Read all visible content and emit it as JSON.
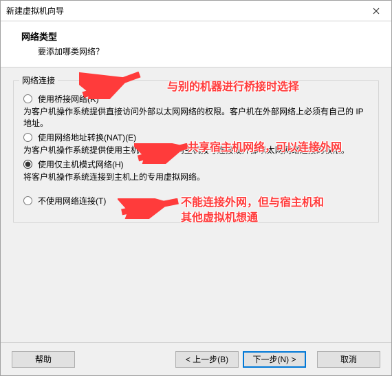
{
  "window": {
    "title": "新建虚拟机向导"
  },
  "header": {
    "heading": "网络类型",
    "subheading": "要添加哪类网络？"
  },
  "fieldset": {
    "legend": "网络连接",
    "options": [
      {
        "label": "使用桥接网络(R)",
        "desc": "为客户机操作系统提供直接访问外部以太网网络的权限。客户机在外部网络上必须有自己的 IP 地址。",
        "checked": false
      },
      {
        "label": "使用网络地址转换(NAT)(E)",
        "desc": "为客户机操作系统提供使用主机 IP 地址访问主机拨号连接或外部以太网网络连接的权限。",
        "checked": false
      },
      {
        "label": "使用仅主机模式网络(H)",
        "desc": "将客户机操作系统连接到主机上的专用虚拟网络。",
        "checked": true
      },
      {
        "label": "不使用网络连接(T)",
        "desc": "",
        "checked": false
      }
    ]
  },
  "footer": {
    "help": "帮助",
    "back": "< 上一步(B)",
    "next": "下一步(N) >",
    "cancel": "取消"
  },
  "annotations": {
    "a1": "与别的机器进行桥接时选择",
    "a2": "共享宿主机网络，可以连接外网",
    "a3_line1": "不能连接外网，但与宿主机和",
    "a3_line2": "其他虚拟机想通"
  },
  "colors": {
    "annotation": "#ff3b3b",
    "accent": "#0078d7"
  }
}
